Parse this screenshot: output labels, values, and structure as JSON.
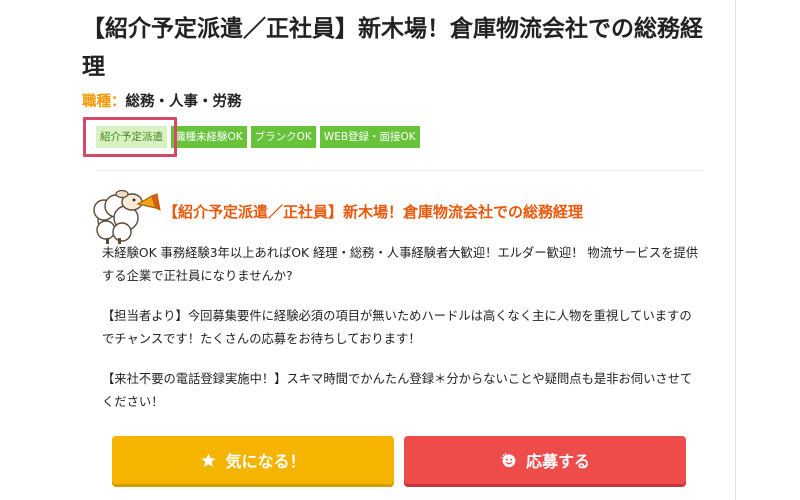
{
  "job": {
    "title": "【紹介予定派遣／正社員】新木場！倉庫物流会社での総務経理",
    "category_label": "職種：",
    "category_value": "総務・人事・労務",
    "tags": [
      "紹介予定派遣",
      "職種未経験OK",
      "ブランクOK",
      "WEB登録・面接OK"
    ]
  },
  "detail": {
    "heading": "【紹介予定派遣／正社員】新木場！倉庫物流会社での総務経理",
    "paragraphs": [
      "未経験OK 事務経験3年以上あればOK 経理・総務・人事経験者大歓迎！エルダー歓迎！ 物流サービスを提供する企業で正社員になりませんか?",
      "【担当者より】今回募集要件に経験必須の項目が無いためハードルは高くなく主に人物を重視していますのでチャンスです！たくさんの応募をお待ちしております！",
      "【来社不要の電話登録実施中！】スキマ時間でかんたん登録＊分からないことや疑問点も是非お伺いさせてください！"
    ]
  },
  "actions": {
    "favorite_label": "気になる！",
    "apply_label": "応募する"
  },
  "icons": {
    "favorite": "star-icon",
    "apply": "smile-icon",
    "mascot": "sheep-mascot-icon"
  },
  "colors": {
    "accent_orange": "#f39800",
    "heading_orange": "#e8590c",
    "tag_green": "#67c33a",
    "favorite_yellow": "#f5b400",
    "apply_red": "#ee4b4b",
    "highlight_red": "#d24a66"
  }
}
